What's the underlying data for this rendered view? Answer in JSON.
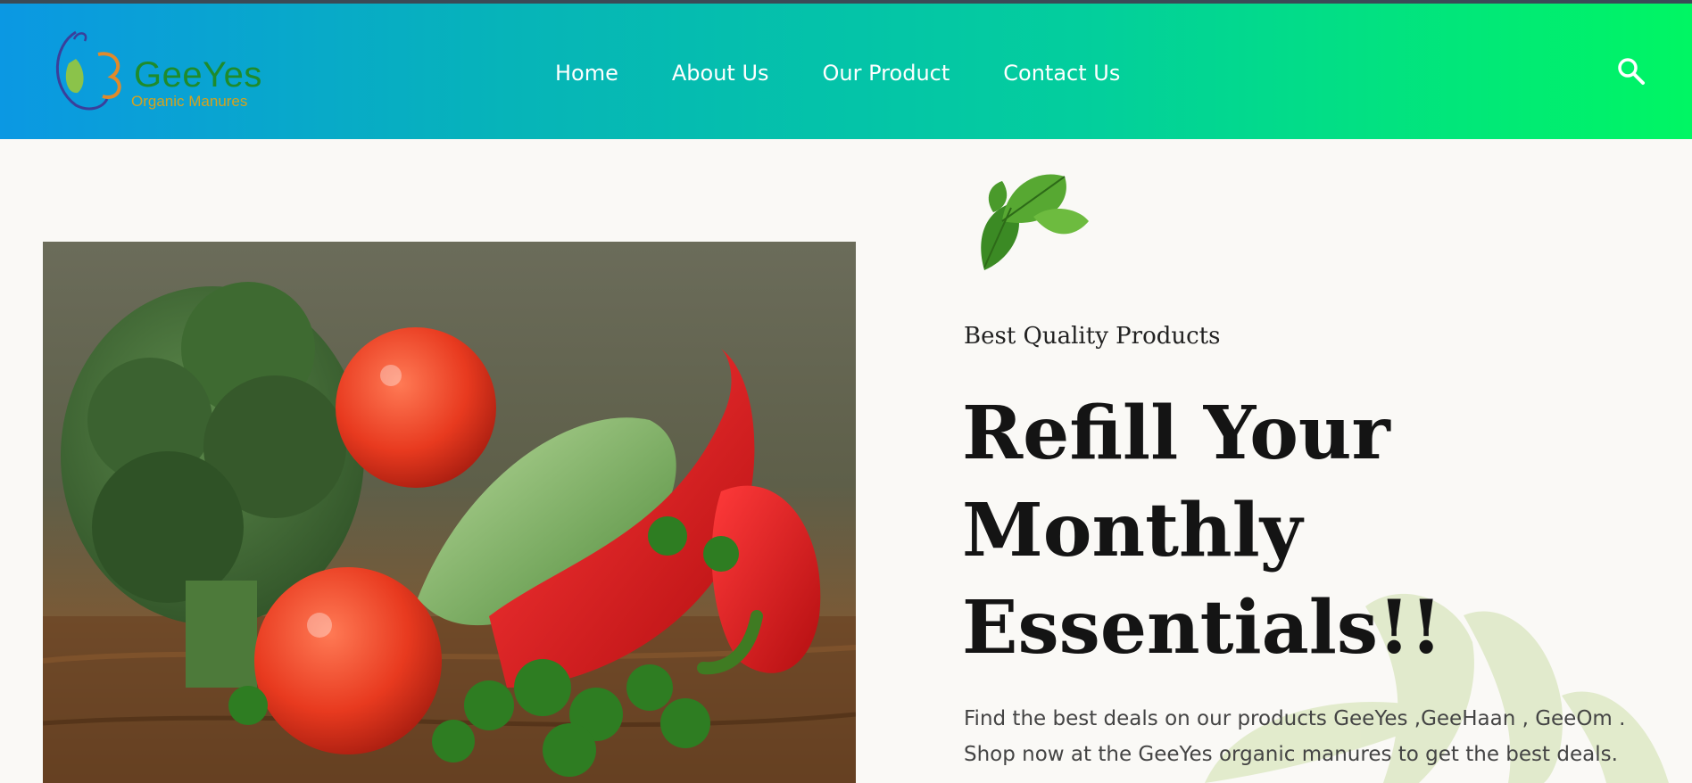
{
  "brand": {
    "name": "GeeYes",
    "tagline": "Organic Manures",
    "primary_color": "#1e8b2c",
    "accent_color": "#d6a21c"
  },
  "header": {
    "gradient_start": "#0b98e3",
    "gradient_end": "#00f663",
    "nav": [
      {
        "label": "Home"
      },
      {
        "label": "About Us"
      },
      {
        "label": "Our Product"
      },
      {
        "label": "Contact Us"
      }
    ],
    "search_icon": "search-icon"
  },
  "hero": {
    "image": "vegetables-photo",
    "subtitle": "Best Quality Products",
    "title": "Refill Your Monthly Essentials!!",
    "description": "Find the best deals on our products GeeYes ,GeeHaan , GeeOm . Shop now at the GeeYes organic manures to get the best deals."
  }
}
